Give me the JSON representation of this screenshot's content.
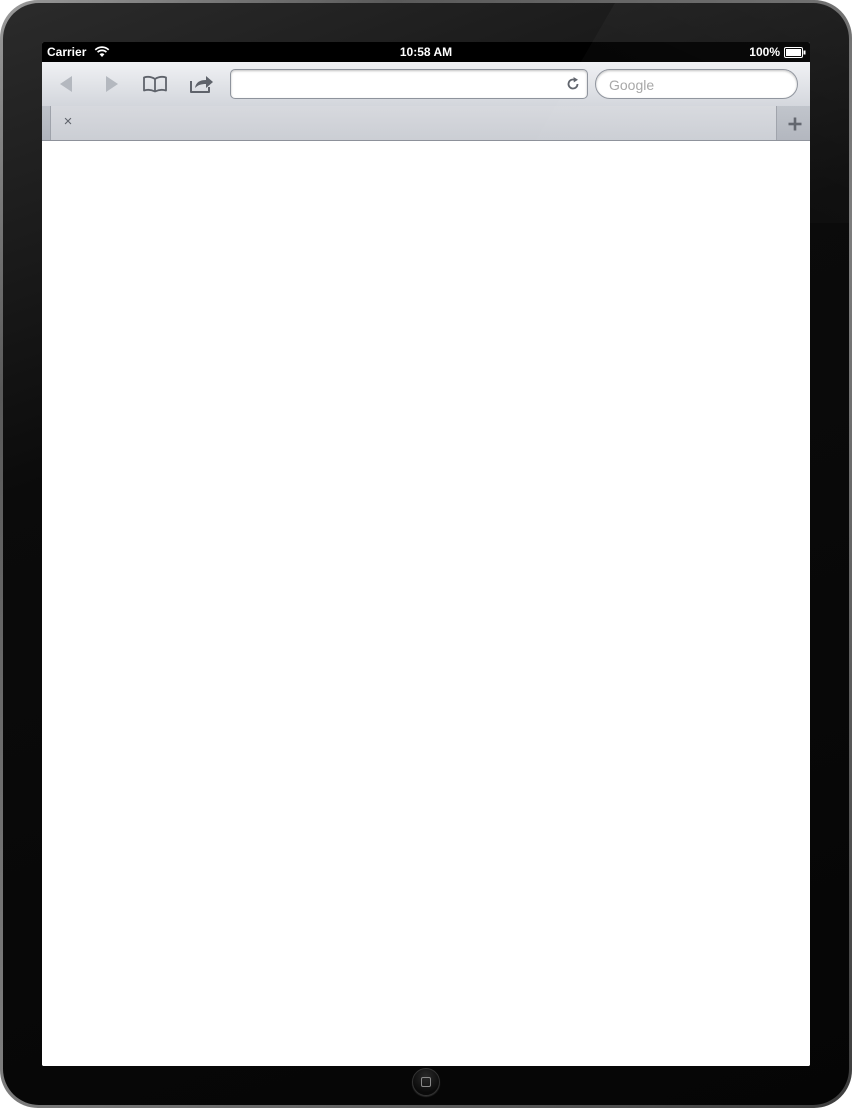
{
  "status_bar": {
    "carrier": "Carrier",
    "time": "10:58 AM",
    "battery": "100%",
    "battery_level": 1.0
  },
  "toolbar": {
    "back_icon": "back-arrow-icon",
    "forward_icon": "forward-arrow-icon",
    "bookmarks_icon": "bookmarks-book-icon",
    "share_icon": "share-arrow-icon",
    "url_value": "",
    "reload_icon": "reload-icon",
    "search_placeholder": "Google",
    "search_value": ""
  },
  "tab_bar": {
    "tabs": [
      {
        "title": "",
        "close_glyph": "×"
      }
    ],
    "new_tab_glyph": "+"
  },
  "colors": {
    "toolbar_top": "#f0f1f4",
    "toolbar_bottom": "#d3d6dc",
    "icon_gray": "#5f636b",
    "disabled_icon": "#b4b8bf"
  }
}
